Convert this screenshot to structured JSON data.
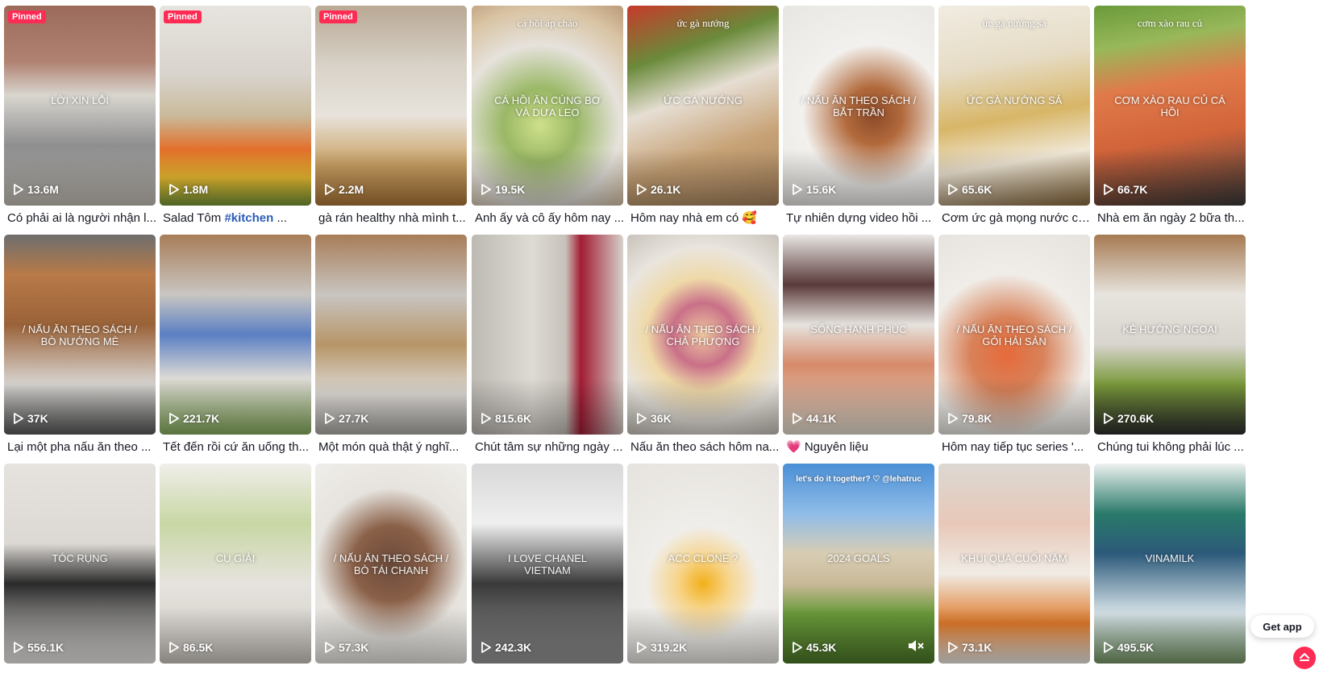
{
  "grid": {
    "videos": [
      {
        "views": "13.6M",
        "desc": "Có phải ai là người nhận l...",
        "hashtag": "",
        "top_text": "",
        "overlay_text": "LỜI XIN LỖI",
        "pinned": true,
        "bg": "linear-gradient(180deg,#9b6a5a 0%,#b08272 28%,#d9d6cf 45%,#8e8e90 70%,#c9c4bb 100%)"
      },
      {
        "views": "1.8M",
        "desc": "Salad Tôm ",
        "hashtag": "#kitchen",
        "desc_tail": " ...",
        "top_text": "",
        "overlay_text": "",
        "pinned": true,
        "bg": "linear-gradient(180deg,#e7e4df 0%,#d8d3cc 35%,#c9ba9a 55%,#e36f2b 72%,#f2c232 86%,#7a9a3a 100%)"
      },
      {
        "views": "2.2M",
        "desc": "gà rán healthy nhà mình t...",
        "hashtag": "",
        "top_text": "",
        "overlay_text": "",
        "pinned": true,
        "bg": "linear-gradient(180deg,#b9a894 0%,#d8d2c8 30%,#e8e3dc 55%,#c9a062 80%,#b17a3b 100%)"
      },
      {
        "views": "19.5K",
        "desc": "Anh ấy và cô ấy hôm nay ...",
        "hashtag": "",
        "top_text": "cá hồi áp chảo",
        "overlay_text": "CÁ HỒI ĂN CÙNG BƠ VÀ DƯA LEO",
        "pinned": false,
        "bg": "radial-gradient(circle at 45% 60%,#cfe08a 0%,#9ab866 25%,#e6e2dc 55%,#d9c4a4 80%,#bb9a78 100%)"
      },
      {
        "views": "26.1K",
        "desc": "Hôm nay nhà em có 🥰",
        "hashtag": "",
        "top_text": "ức gà nướng",
        "overlay_text": "ỨC GÀ NƯỚNG",
        "pinned": false,
        "bg": "linear-gradient(160deg,#c73a2a 0%,#6a8a3a 25%,#e6ded3 45%,#c7a276 70%,#a8845e 100%)"
      },
      {
        "views": "15.6K",
        "desc": "Tự nhiên dựng video hồi ...",
        "hashtag": "",
        "top_text": "",
        "overlay_text": "/ nấu ăn theo sách / BẮT TRẦN",
        "pinned": false,
        "bg": "radial-gradient(circle at 60% 55%,#8c4a2a 0%,#b26a3c 20%,#f3f1ee 50%,#e8e6e2 100%)"
      },
      {
        "views": "65.6K",
        "desc": "Cơm ức gà mọng nước củ...",
        "hashtag": "",
        "top_text": "ức gà nướng sả",
        "overlay_text": "ỨC GÀ NƯỚNG SẢ",
        "pinned": false,
        "bg": "linear-gradient(170deg,#f1ece2 0%,#e6dcc6 30%,#d8b667 55%,#f0e7d6 75%,#8a6a3c 100%)"
      },
      {
        "views": "66.7K",
        "desc": "Nhà em ăn ngày 2 bữa th...",
        "hashtag": "",
        "top_text": "cơm xào rau củ",
        "overlay_text": "CƠM XÀO RAU CỦ CÁ HỒI",
        "pinned": false,
        "bg": "linear-gradient(170deg,#6a9a3a 0%,#98b85a 20%,#e07a4a 40%,#d2643a 65%,#3a3a3a 100%)"
      },
      {
        "views": "37K",
        "desc": "Lại một pha nấu ăn theo ...",
        "hashtag": "",
        "top_text": "",
        "overlay_text": "/ nấu ăn theo sách / BÒ NƯỚNG MÈ",
        "pinned": false,
        "bg": "linear-gradient(180deg,#6e6e6e 0%,#b87a48 20%,#9a6238 45%,#d8d6d2 75%,#5a5a5a 100%)"
      },
      {
        "views": "221.7K",
        "desc": "Tết đến rồi cứ ăn uống th...",
        "hashtag": "",
        "top_text": "",
        "overlay_text": "",
        "pinned": false,
        "bg": "linear-gradient(180deg,#a77d58 0%,#c9c6c2 30%,#5b7fc2 50%,#dedbd6 72%,#8ab060 100%)"
      },
      {
        "views": "27.7K",
        "desc": "Một món quà thật ý nghĩ...",
        "hashtag": "",
        "top_text": "",
        "overlay_text": "",
        "pinned": false,
        "bg": "linear-gradient(180deg,#a77d58 0%,#c8c5c1 30%,#b79568 55%,#dedbd6 80%,#b0aeaa 100%)"
      },
      {
        "views": "815.6K",
        "desc": "Chút tâm sự những ngày ...",
        "hashtag": "",
        "top_text": "",
        "overlay_text": "",
        "pinned": false,
        "bg": "linear-gradient(90deg,#bdb9b3 0%,#dedad4 40%,#c7c2bb 62%,#a21c34 72%,#d6d1ca 100%)"
      },
      {
        "views": "36K",
        "desc": "Nấu ăn theo sách hôm na...",
        "hashtag": "",
        "top_text": "",
        "overlay_text": "/ nấu ăn theo sách / CHẢ PHƯỢNG",
        "pinned": false,
        "bg": "radial-gradient(circle at 50% 50%,#f0c9a0 0%,#c97088 25%,#efd9a8 45%,#e9e5de 70%,#c8c2ba 100%)"
      },
      {
        "views": "44.1K",
        "desc": "💗 Nguyên liệu",
        "hashtag": "",
        "top_text": "",
        "overlay_text": "SỐNG HẠNH PHÚC",
        "pinned": false,
        "bg": "linear-gradient(180deg,#e9e7e4 0%,#5a3a3a 25%,#e6e3de 45%,#d68a6a 65%,#e8e2d4 100%)"
      },
      {
        "views": "79.8K",
        "desc": "Hôm nay tiếp tục series '...",
        "hashtag": "",
        "top_text": "",
        "overlay_text": "/ nấu ăn theo sách / GỎI HẢI SẢN",
        "pinned": false,
        "bg": "radial-gradient(circle at 45% 60%,#e66a3a 0%,#d8825a 25%,#f0ede8 55%,#e6e3de 100%)"
      },
      {
        "views": "270.6K",
        "desc": "Chúng tui không phải lúc ...",
        "hashtag": "",
        "top_text": "",
        "overlay_text": "KẺ HƯỚNG NGOẠI",
        "pinned": false,
        "bg": "linear-gradient(180deg,#a67a52 0%,#e7e4de 30%,#d8d4ce 55%,#7a9a3a 75%,#2e2e2e 100%)"
      },
      {
        "views": "556.1K",
        "desc": "",
        "hashtag": "",
        "top_text": "",
        "overlay_text": "TÓC RỤNG",
        "pinned": false,
        "bg": "linear-gradient(180deg,#e6e3df 0%,#dcd8d3 40%,#2a2a2a 60%,#f2f0ed 100%)"
      },
      {
        "views": "86.5K",
        "desc": "",
        "hashtag": "",
        "top_text": "",
        "overlay_text": "CỤ GIẢI",
        "pinned": false,
        "bg": "linear-gradient(180deg,#f0eeea 0%,#c8d7a4 30%,#e6e3de 60%,#cfcac3 100%)"
      },
      {
        "views": "57.3K",
        "desc": "",
        "hashtag": "",
        "top_text": "",
        "overlay_text": "/ nấu ăn theo sách / BÒ TÁI CHANH",
        "pinned": false,
        "bg": "radial-gradient(circle at 50% 50%,#6a4a3a 0%,#8a6048 30%,#e6e3de 60%,#f0eeea 100%)"
      },
      {
        "views": "242.3K",
        "desc": "",
        "hashtag": "",
        "top_text": "",
        "overlay_text": "I LOVE CHANEL VIETNAM",
        "pinned": false,
        "bg": "linear-gradient(180deg,#d8d8d8 0%,#efefef 30%,#3a3a3a 60%,#9a9a9a 100%)"
      },
      {
        "views": "319.2K",
        "desc": "",
        "hashtag": "",
        "top_text": "",
        "overlay_text": "ACC CLONE ?",
        "pinned": false,
        "bg": "radial-gradient(circle at 50% 60%,#f2b01a 0%,#f7d48a 18%,#f0eeea 40%,#e6e3de 100%)"
      },
      {
        "views": "45.3K",
        "desc": "",
        "hashtag": "",
        "top_text": "let's do it together? ♡ @lehatruc",
        "overlay_text": "2024 GOALS",
        "pinned": false,
        "bg": "linear-gradient(180deg,#4a8fd6 0%,#8fbce8 25%,#d8cdb4 45%,#c9b998 60%,#6a9a3a 75%,#4e7a2a 100%)"
      },
      {
        "views": "73.1K",
        "desc": "",
        "hashtag": "",
        "top_text": "",
        "overlay_text": "KHUI QUÀ CUỐI NĂM",
        "pinned": false,
        "bg": "linear-gradient(180deg,#dcd8d2 0%,#e8c8b8 30%,#f0ece6 55%,#e07a2a 80%,#f2f0ed 100%)"
      },
      {
        "views": "495.5K",
        "desc": "",
        "hashtag": "",
        "top_text": "",
        "overlay_text": "VINAMILK",
        "pinned": false,
        "bg": "linear-gradient(180deg,#eef2f0 0%,#2a7a6a 25%,#2c5a7a 45%,#d6e2e8 75%,#7a9a6a 100%)"
      }
    ]
  },
  "ui": {
    "pinned_label": "Pinned",
    "get_app_label": "Get app"
  }
}
